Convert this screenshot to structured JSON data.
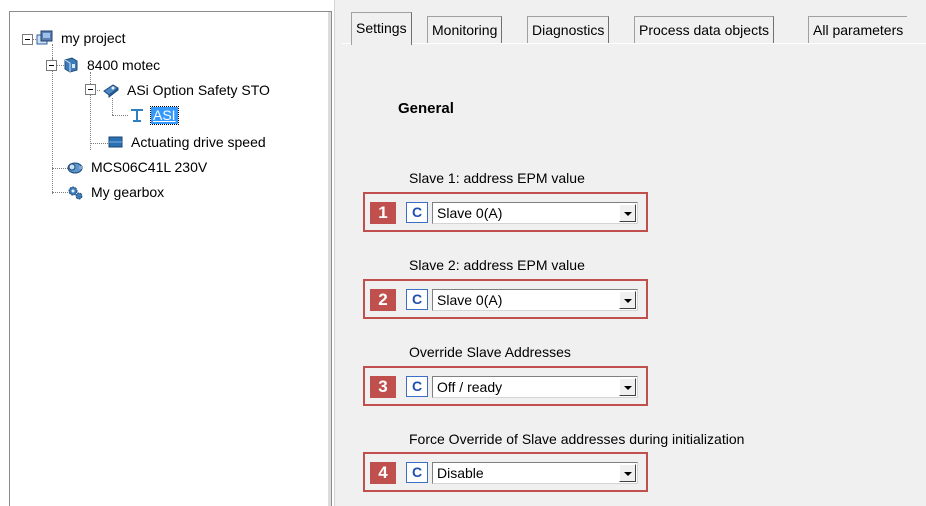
{
  "tree": {
    "items": [
      {
        "label": "my project",
        "icon": "project-icon"
      },
      {
        "label": "8400 motec",
        "icon": "drive-icon"
      },
      {
        "label": "ASi Option Safety STO",
        "icon": "option-module-icon"
      },
      {
        "label": "ASI",
        "icon": "asi-interface-icon"
      },
      {
        "label": "Actuating drive speed",
        "icon": "function-block-icon"
      },
      {
        "label": "MCS06C41L 230V",
        "icon": "motor-icon"
      },
      {
        "label": "My gearbox",
        "icon": "gearbox-icon"
      }
    ]
  },
  "tabs": [
    {
      "label": "Settings"
    },
    {
      "label": "Monitoring"
    },
    {
      "label": "Diagnostics"
    },
    {
      "label": "Process data objects"
    },
    {
      "label": "All parameters"
    }
  ],
  "settings": {
    "section_title": "General",
    "params": [
      {
        "label": "Slave 1: address EPM value",
        "badge": "1",
        "button": "C",
        "value": "Slave  0(A)"
      },
      {
        "label": "Slave 2: address EPM value",
        "badge": "2",
        "button": "C",
        "value": "Slave  0(A)"
      },
      {
        "label": "Override Slave Addresses",
        "badge": "3",
        "button": "C",
        "value": "Off / ready"
      },
      {
        "label": "Force Override of Slave addresses during initialization",
        "badge": "4",
        "button": "C",
        "value": "Disable"
      }
    ]
  },
  "colors": {
    "highlight_box": "#c0504d",
    "selection": "#3399ff",
    "panel_bg": "#f0f0f0"
  }
}
